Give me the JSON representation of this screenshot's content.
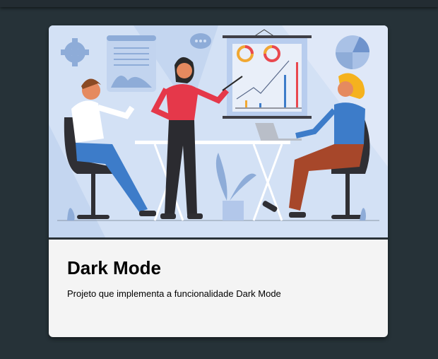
{
  "card": {
    "title": "Dark Mode",
    "description": "Projeto que implementa a funcionalidade Dark Mode",
    "image_alt": "Illustration of a team meeting with a presentation chart"
  },
  "colors": {
    "background": "#263238",
    "card": "#f4f4f4",
    "illustration_bg": "#d3e1f5"
  }
}
